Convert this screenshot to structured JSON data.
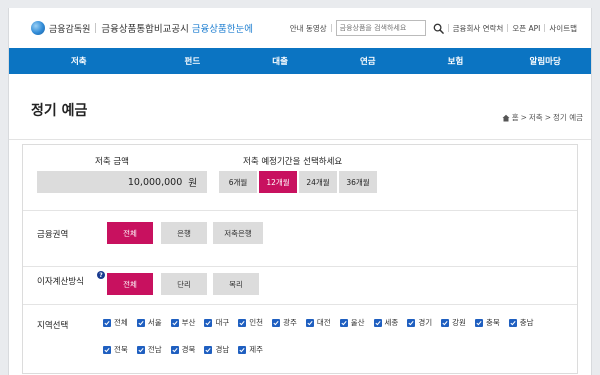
{
  "header": {
    "agency_name": "금융감독원",
    "site_title": "금융상품통합비교공시",
    "site_title_highlight": "금융상품한눈에",
    "guide_video_label": "안내 동영상",
    "search_placeholder": "금융상품을 검색하세요",
    "company_contacts_label": "금융회사 연락처",
    "open_api_label": "오픈 API",
    "sitemap_label": "사이트맵"
  },
  "nav": {
    "items": [
      "저축",
      "펀드",
      "대출",
      "연금",
      "보험",
      "알림마당"
    ]
  },
  "page": {
    "title": "정기 예금",
    "breadcrumb": {
      "home": "홈",
      "level1": "저축",
      "level2": "정기 예금",
      "separator": ">"
    }
  },
  "form": {
    "amount_label": "저축 금액",
    "amount_value": "10,000,000",
    "amount_unit": "원",
    "period_label": "저축 예정기간을 선택하세요",
    "periods": [
      "6개월",
      "12개월",
      "24개월",
      "36개월"
    ],
    "selected_period": "12개월",
    "sector_label": "금융권역",
    "sectors": [
      "전체",
      "은행",
      "저축은행"
    ],
    "selected_sector": "전체",
    "interest_label": "이자계산방식",
    "interest_info": "?",
    "interest_methods": [
      "전체",
      "단리",
      "복리"
    ],
    "selected_interest": "전체",
    "region_label": "지역선택",
    "regions": [
      "전체",
      "서울",
      "부산",
      "대구",
      "인천",
      "광주",
      "대전",
      "울산",
      "세종",
      "경기",
      "강원",
      "충북",
      "충남",
      "전북",
      "전남",
      "경북",
      "경남",
      "제주"
    ]
  },
  "colors": {
    "brand_blue": "#0b74c2",
    "accent": "#c8115f",
    "checkbox": "#1f5fc0"
  }
}
